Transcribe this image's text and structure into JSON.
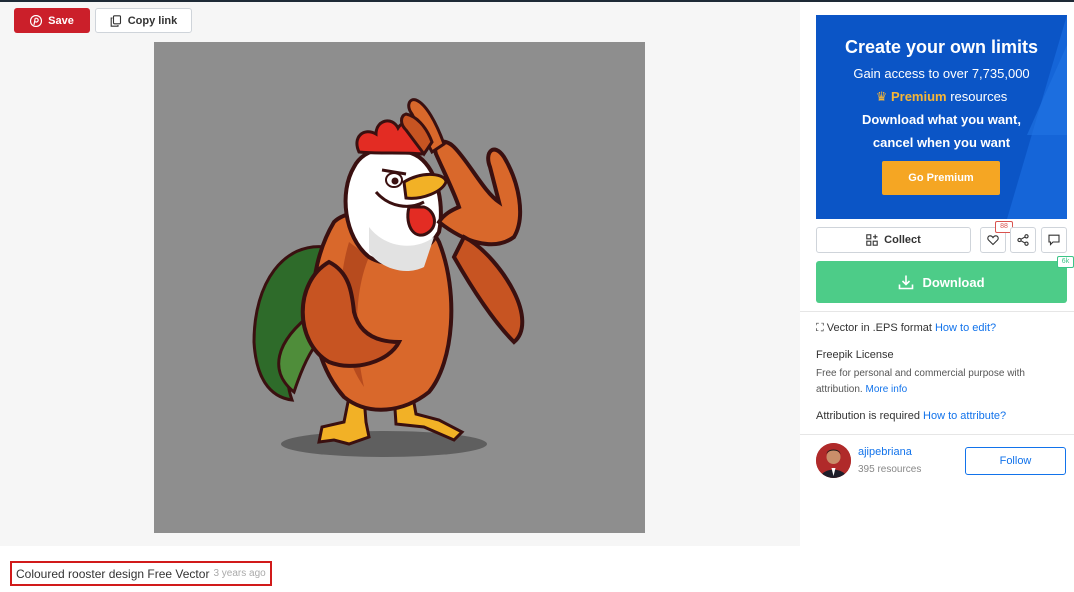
{
  "toolbar": {
    "save_label": "Save",
    "copy_link_label": "Copy link"
  },
  "preview": {
    "background_color": "#8e8e8e",
    "subject": "rooster-illustration"
  },
  "promo": {
    "title": "Create your own limits",
    "line1": "Gain access to over 7,735,000",
    "premium_word": "Premium",
    "line2_rest": " resources",
    "line3": "Download what you want,",
    "line4": "cancel when you want",
    "cta_label": "Go Premium",
    "background_color": "#0b55c6",
    "cta_color": "#f5a623"
  },
  "actions": {
    "collect_label": "Collect",
    "like_count": "88",
    "download_label": "Download",
    "download_count": "6k"
  },
  "file_info": {
    "format_text": "Vector in .EPS format",
    "how_to_edit": "How to edit?",
    "license_title": "Freepik License",
    "license_desc": "Free for personal and commercial purpose with attribution.",
    "more_info": "More info",
    "attribution_text": "Attribution is required",
    "how_to_attribute": "How to attribute?"
  },
  "author": {
    "name": "ajipebriana",
    "resources": "395 resources",
    "follow_label": "Follow"
  },
  "resource": {
    "title": "Coloured rooster design Free Vector",
    "age": "3 years ago"
  }
}
